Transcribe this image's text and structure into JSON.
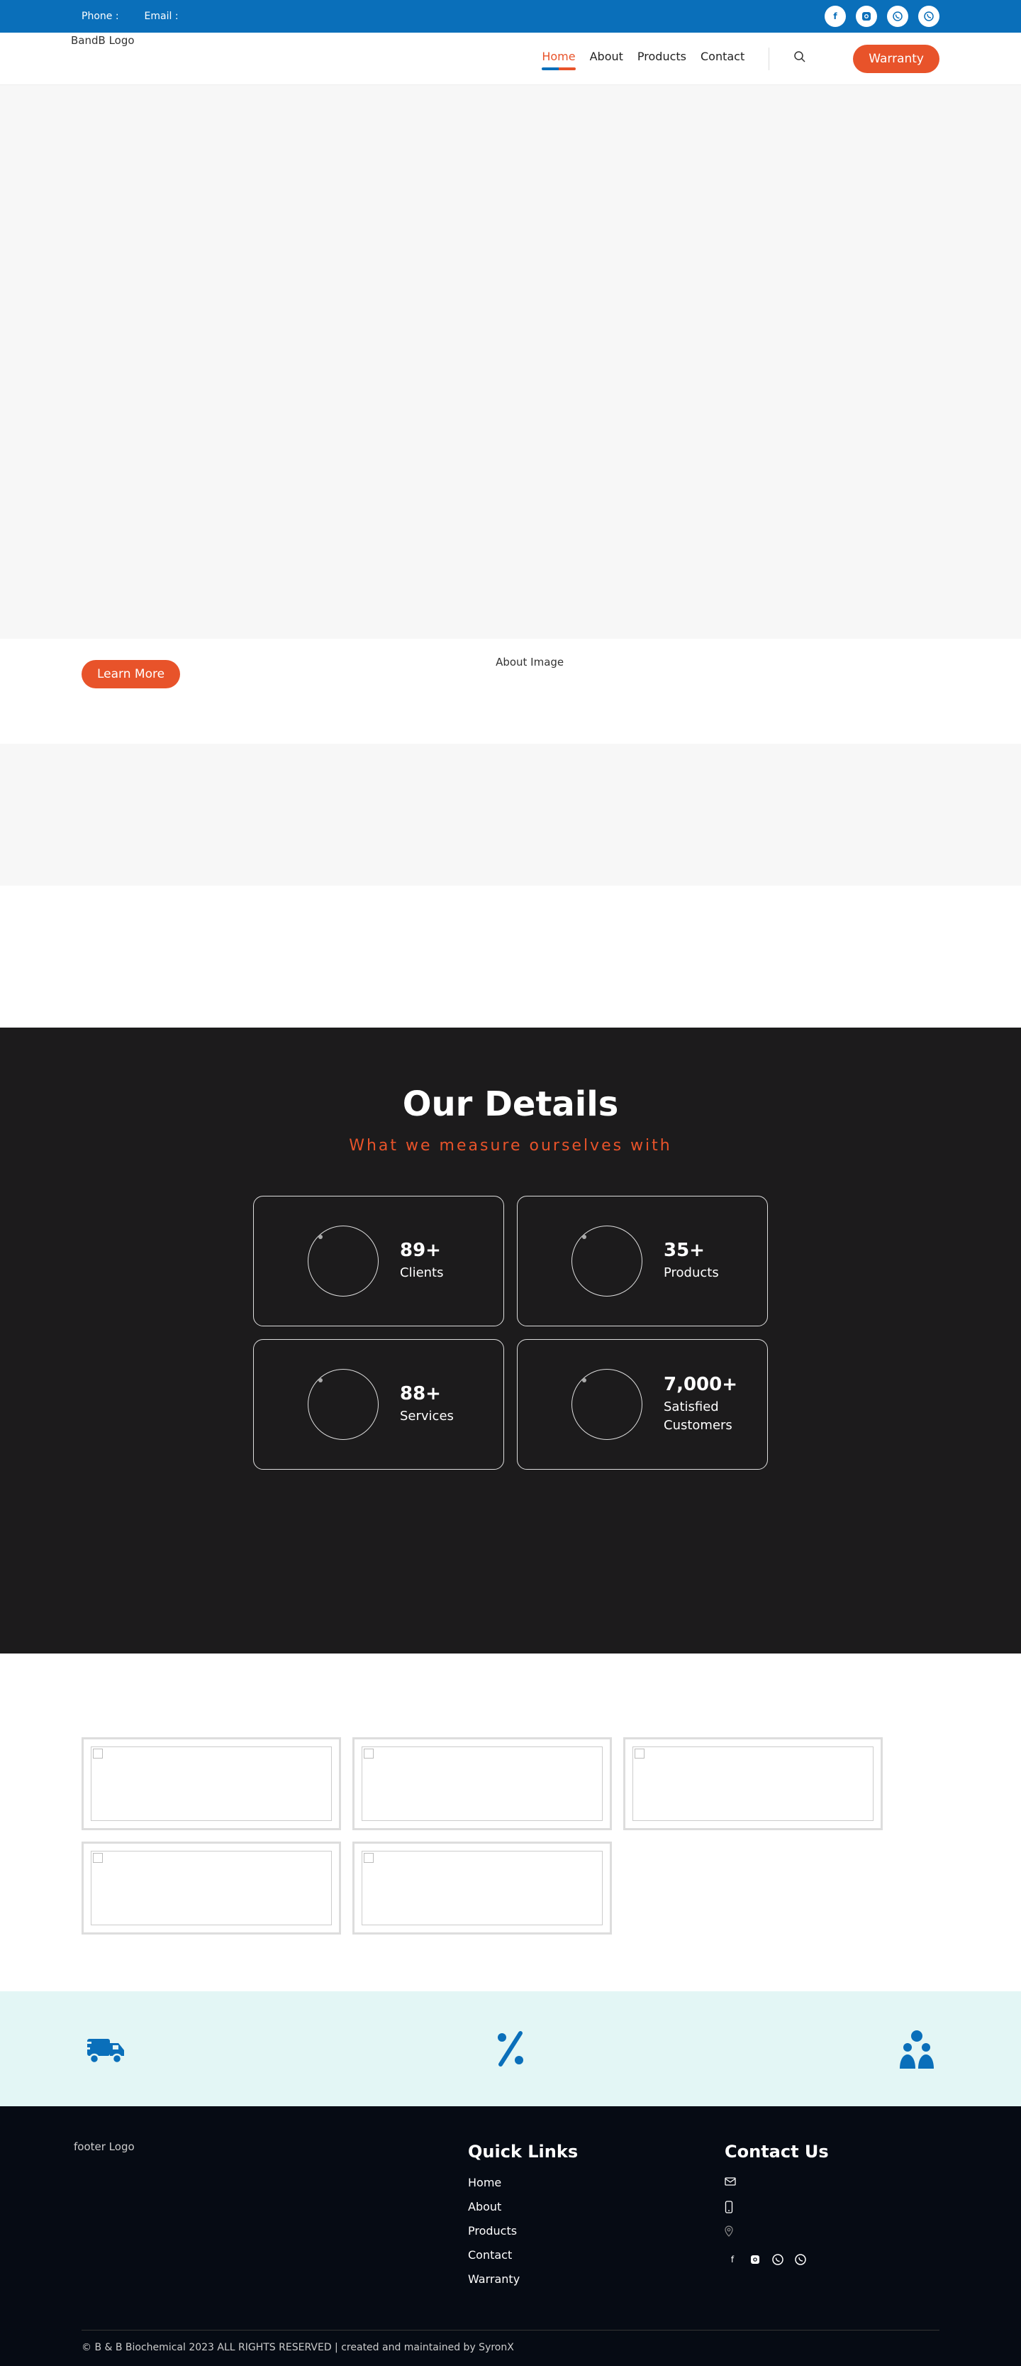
{
  "topbar": {
    "phone_label": "Phone :",
    "email_label": "Email :",
    "socials": [
      "facebook-icon",
      "instagram-icon",
      "whatsapp-icon",
      "viber-icon"
    ]
  },
  "header": {
    "logo_alt": "BandB Logo",
    "nav": [
      {
        "label": "Home",
        "active": true
      },
      {
        "label": "About"
      },
      {
        "label": "Products"
      },
      {
        "label": "Contact"
      }
    ],
    "warranty_label": "Warranty"
  },
  "about": {
    "learn_more": "Learn More",
    "image_alt": "About Image"
  },
  "details": {
    "title": "Our Details",
    "subtitle": "What we measure ourselves with",
    "stats": [
      {
        "value": "89+",
        "label": "Clients"
      },
      {
        "value": "35+",
        "label": "Products"
      },
      {
        "value": "88+",
        "label": "Services"
      },
      {
        "value": "7,000+",
        "label": "Satisfied Customers"
      }
    ]
  },
  "footer": {
    "logo_alt": "footer Logo",
    "quick_links_title": "Quick Links",
    "quick_links": [
      "Home",
      "About",
      "Products",
      "Contact",
      "Warranty"
    ],
    "contact_title": "Contact Us",
    "copyright": "© B & B Biochemical 2023 ALL RIGHTS RESERVED | created and maintained by SyronX"
  },
  "colors": {
    "primary": "#0a6fba",
    "accent": "#e8532a",
    "dark": "#1c1b1c",
    "footer": "#060b14",
    "feature_bg": "#e3f6f5"
  }
}
